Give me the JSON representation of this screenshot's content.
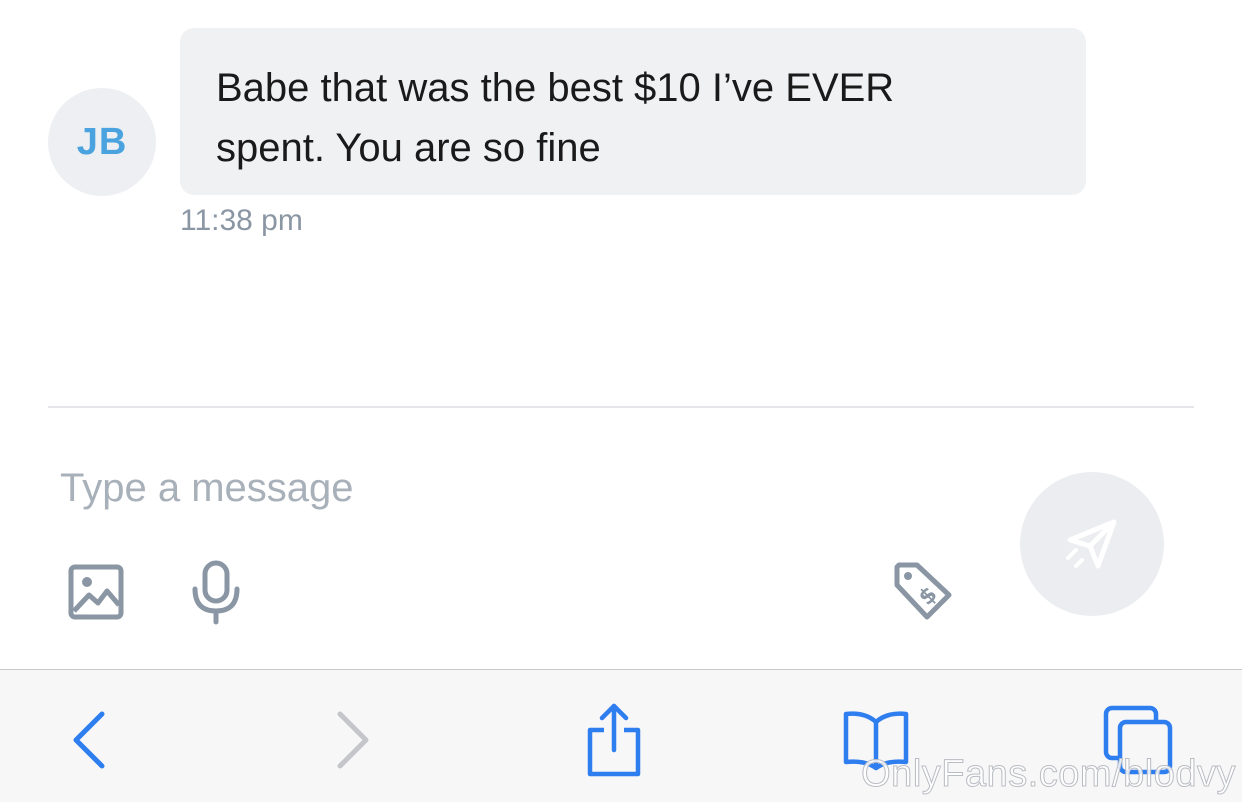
{
  "message": {
    "avatar_initials": "JB",
    "text": "Babe that was the best $10 I’ve EVER spent. You are so fine",
    "time": "11:38 pm"
  },
  "composer": {
    "placeholder": "Type a message",
    "icons": {
      "image": "image-icon",
      "mic": "microphone-icon",
      "price": "price-tag-icon",
      "send": "send-icon"
    }
  },
  "browser_toolbar": {
    "icons": [
      "back-icon",
      "forward-icon",
      "share-icon",
      "bookmarks-icon",
      "tabs-icon"
    ]
  },
  "watermark": "OnlyFans.com/blodvy",
  "colors": {
    "accent_blue": "#2f7ef0",
    "avatar_text": "#4aa3df",
    "icon_gray": "#8a96a3",
    "timestamp": "#8a96a3"
  }
}
